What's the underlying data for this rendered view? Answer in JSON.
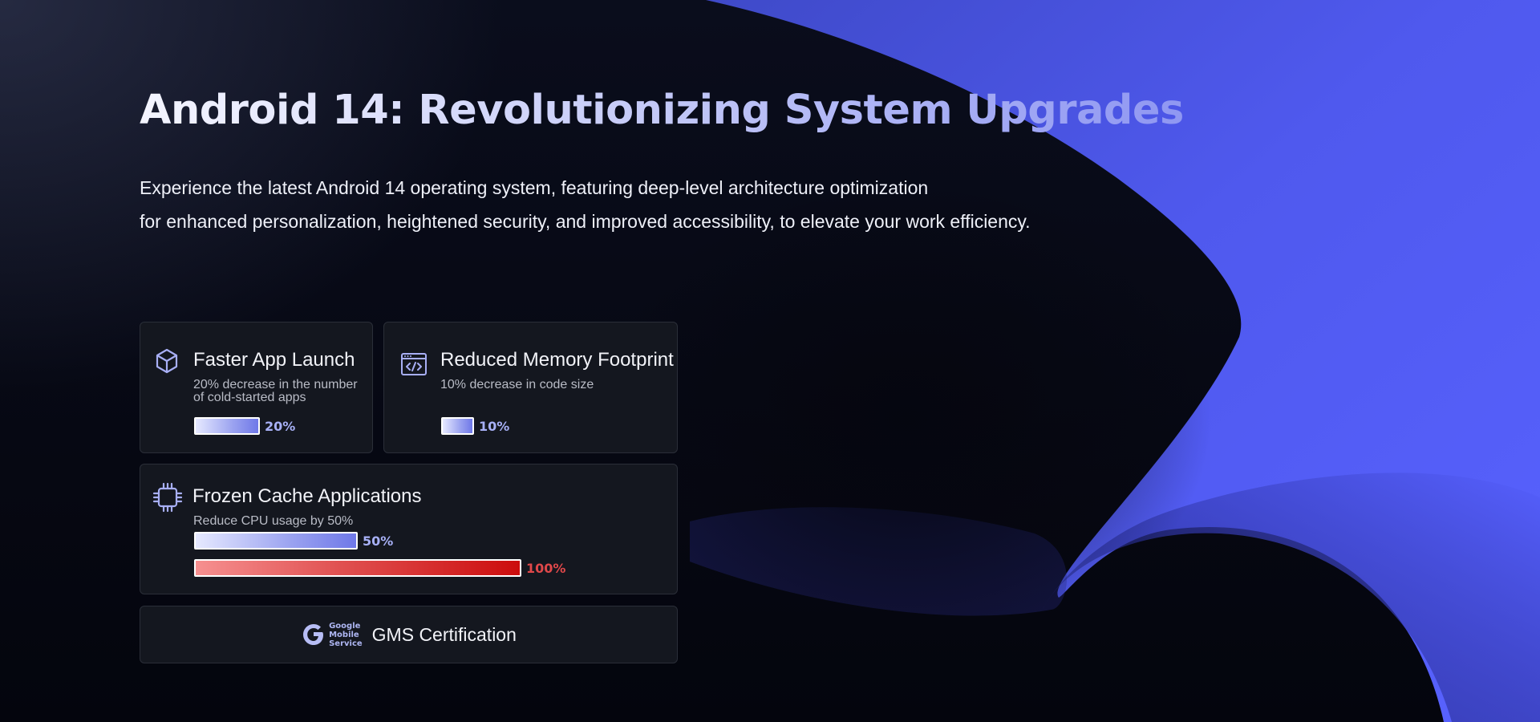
{
  "hero": {
    "title": "Android 14: Revolutionizing System Upgrades",
    "description_line1": "Experience the latest Android 14 operating system, featuring deep-level architecture optimization",
    "description_line2": "for enhanced personalization, heightened security, and improved accessibility, to elevate your work efficiency."
  },
  "features": {
    "app_launch": {
      "icon": "cube-icon",
      "title": "Faster App Launch",
      "desc_line1": "20% decrease in the number",
      "desc_line2": "of cold-started apps",
      "bar_label": "20%",
      "bar_value": 0.2
    },
    "memory": {
      "icon": "code-window-icon",
      "title": "Reduced Memory Footprint",
      "desc": "10% decrease in code size",
      "bar_label": "10%",
      "bar_value": 0.1
    },
    "frozen_cache": {
      "icon": "cpu-chip-icon",
      "title": "Frozen Cache Applications",
      "desc": "Reduce CPU usage by 50%",
      "bars": [
        {
          "label": "50%",
          "value": 0.5,
          "color": "blue"
        },
        {
          "label": "100%",
          "value": 1.0,
          "color": "red"
        }
      ]
    },
    "gms": {
      "logo_line1": "Google",
      "logo_line2": "Mobile",
      "logo_line3": "Service",
      "label": "GMS Certification"
    }
  },
  "colors": {
    "accent": "#6b73f5",
    "card_bg": "#14171f",
    "bar_blue": "#6f78e8",
    "bar_red": "#cc0c0c"
  }
}
